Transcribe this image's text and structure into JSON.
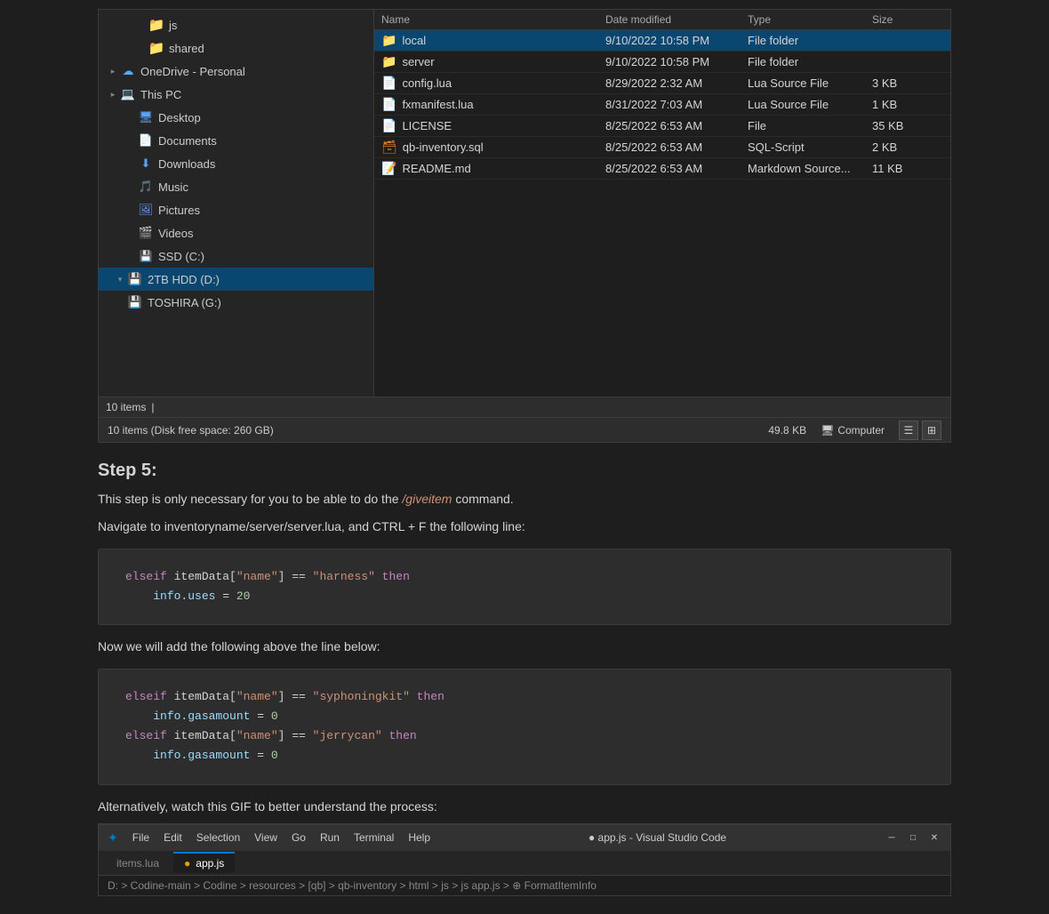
{
  "explorer": {
    "sidebar": {
      "items": [
        {
          "id": "js",
          "label": "js",
          "icon": "folder",
          "indent": 40,
          "expand": "",
          "selected": false
        },
        {
          "id": "shared",
          "label": "shared",
          "icon": "folder",
          "indent": 40,
          "expand": "",
          "selected": false
        },
        {
          "id": "onedrive",
          "label": "OneDrive - Personal",
          "icon": "cloud",
          "indent": 8,
          "expand": "▸",
          "selected": false
        },
        {
          "id": "thispc",
          "label": "This PC",
          "icon": "pc",
          "indent": 8,
          "expand": "▸",
          "selected": false
        },
        {
          "id": "desktop",
          "label": "Desktop",
          "icon": "desktop",
          "indent": 28,
          "expand": "",
          "selected": false
        },
        {
          "id": "documents",
          "label": "Documents",
          "icon": "docs",
          "indent": 28,
          "expand": "",
          "selected": false
        },
        {
          "id": "downloads",
          "label": "Downloads",
          "icon": "downloads",
          "indent": 28,
          "expand": "",
          "selected": false
        },
        {
          "id": "music",
          "label": "Music",
          "icon": "music",
          "indent": 28,
          "expand": "",
          "selected": false
        },
        {
          "id": "pictures",
          "label": "Pictures",
          "icon": "pictures",
          "indent": 28,
          "expand": "",
          "selected": false
        },
        {
          "id": "videos",
          "label": "Videos",
          "icon": "videos",
          "indent": 28,
          "expand": "",
          "selected": false
        },
        {
          "id": "ssd",
          "label": "SSD (C:)",
          "icon": "ssd",
          "indent": 28,
          "expand": "",
          "selected": false
        },
        {
          "id": "hdd",
          "label": "2TB HDD (D:)",
          "icon": "drive",
          "indent": 16,
          "expand": "▾",
          "selected": true
        },
        {
          "id": "toshiba",
          "label": "TOSHIRA (G:)",
          "icon": "drive",
          "indent": 16,
          "expand": "",
          "selected": false
        }
      ]
    },
    "files": [
      {
        "name": "local",
        "icon": "folder",
        "date": "9/10/2022 10:58 PM",
        "type": "File folder",
        "size": "",
        "selected": true
      },
      {
        "name": "server",
        "icon": "folder",
        "date": "9/10/2022 10:58 PM",
        "type": "File folder",
        "size": ""
      },
      {
        "name": "config.lua",
        "icon": "lua",
        "date": "8/29/2022 2:32 AM",
        "type": "Lua Source File",
        "size": "3 KB"
      },
      {
        "name": "fxmanifest.lua",
        "icon": "lua",
        "date": "8/31/2022 7:03 AM",
        "type": "Lua Source File",
        "size": "1 KB"
      },
      {
        "name": "LICENSE",
        "icon": "file",
        "date": "8/25/2022 6:53 AM",
        "type": "File",
        "size": "35 KB"
      },
      {
        "name": "qb-inventory.sql",
        "icon": "sql",
        "date": "8/25/2022 6:53 AM",
        "type": "SQL-Script",
        "size": "2 KB"
      },
      {
        "name": "README.md",
        "icon": "md",
        "date": "8/25/2022 6:53 AM",
        "type": "Markdown Source...",
        "size": "11 KB"
      }
    ],
    "status_items": "10 items",
    "status_bottom": "10 items (Disk free space: 260 GB)",
    "status_size": "49.8 KB",
    "status_computer": "Computer"
  },
  "step5": {
    "heading": "Step 5:",
    "para1": "This step is only necessary for you to be able to do the ",
    "command": "/giveitem",
    "para1_end": " command.",
    "para2": "Navigate to inventoryname/server/server.lua, and CTRL + F the following line:"
  },
  "code1": {
    "line1": "elseif itemData[\"name\"] == \"harness\" then",
    "line2": "    info.uses = 20"
  },
  "code2": {
    "label": "Now we will add the following above the line below:",
    "line1": "elseif itemData[\"name\"] == \"syphoningkit\" then",
    "line2": "    info.gasamount = 0",
    "line3": "elseif itemData[\"name\"] == \"jerrycan\" then",
    "line4": "    info.gasamount = 0"
  },
  "alt_text": "Alternatively, watch this GIF to better understand the process:",
  "vscode": {
    "title": "● app.js - Visual Studio Code",
    "menus": [
      "File",
      "Edit",
      "Selection",
      "View",
      "Go",
      "Run",
      "Terminal",
      "Help"
    ],
    "tabs": [
      {
        "label": "items.lua",
        "active": false,
        "dot": false
      },
      {
        "label": "app.js",
        "active": true,
        "dot": true
      }
    ],
    "breadcrumb": "D: > Codine-main > Codine > resources > [qb] > qb-inventory > html > js > js app.js > ⊕ FormatItemInfo"
  }
}
